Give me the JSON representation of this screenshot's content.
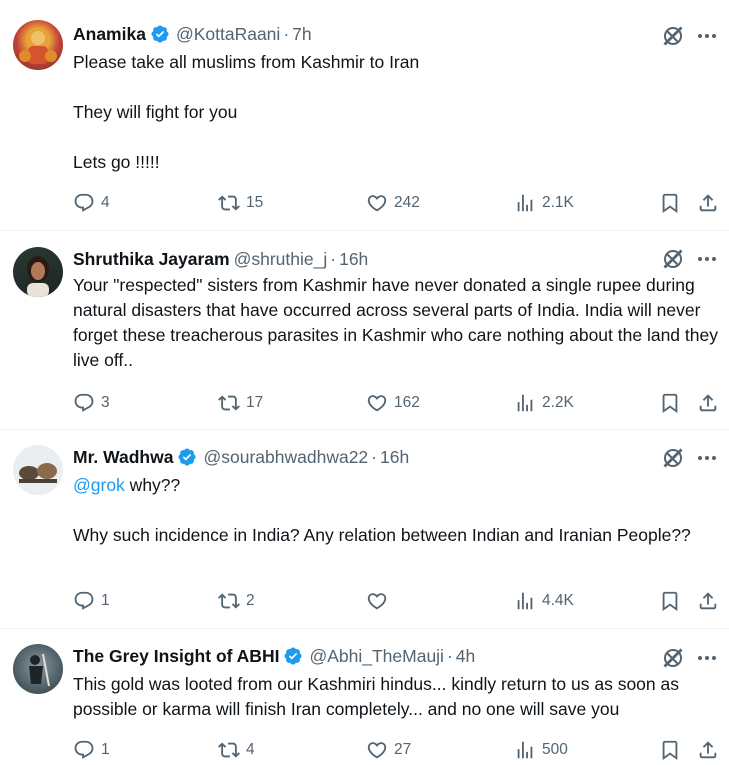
{
  "tweets": [
    {
      "name": "Anamika",
      "verified": true,
      "handle": "@KottaRaani",
      "separator": "·",
      "time": "7h",
      "lines": [
        "Please take all muslims from Kashmir to Iran",
        "They will fight for you",
        "Lets go !!!!!"
      ],
      "reply": "4",
      "retweet": "15",
      "like": "242",
      "views": "2.1K"
    },
    {
      "name": "Shruthika Jayaram",
      "verified": false,
      "handle": "@shruthie_j",
      "separator": "·",
      "time": "16h",
      "text": "Your \"respected\" sisters from Kashmir have never donated a single rupee during natural disasters that have occurred across several parts of India. India will never forget these treacherous parasites in Kashmir who care nothing about the land they live off..",
      "reply": "3",
      "retweet": "17",
      "like": "162",
      "views": "2.2K"
    },
    {
      "name": "Mr. Wadhwa",
      "verified": true,
      "handle": "@sourabhwadhwa22",
      "separator": "·",
      "time": "16h",
      "mention": "@grok",
      "line1_rest": " why??",
      "line2": "Why such incidence in India? Any relation between Indian and Iranian People??",
      "reply": "1",
      "retweet": "2",
      "like": "",
      "views": "4.4K"
    },
    {
      "name": "The Grey Insight of ABHI",
      "verified": true,
      "handle": "@Abhi_TheMauji",
      "separator": "·",
      "time": "4h",
      "text": "This gold was looted from our Kashmiri hindus... kindly return to us as soon as possible or karma will finish Iran completely... and no one will save you",
      "reply": "1",
      "retweet": "4",
      "like": "27",
      "views": "500"
    }
  ],
  "colors": {
    "accent": "#1d9bf0",
    "secondary": "#536471",
    "text": "#0f1419"
  },
  "icons": [
    "reply-icon",
    "retweet-icon",
    "like-icon",
    "views-icon",
    "bookmark-icon",
    "share-icon",
    "grok-icon",
    "more-icon",
    "verified-badge-icon"
  ]
}
